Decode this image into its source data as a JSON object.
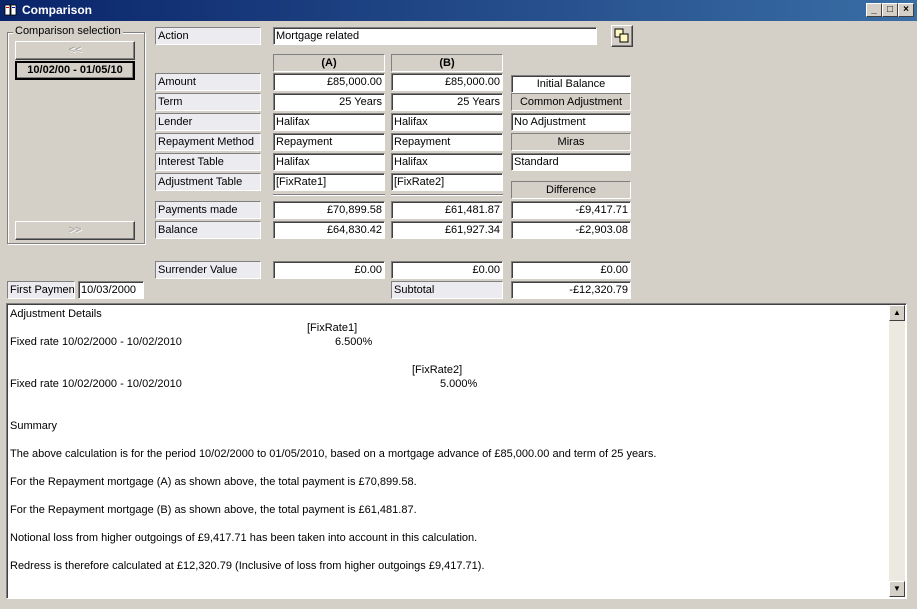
{
  "window": {
    "title": "Comparison"
  },
  "selection": {
    "legend": "Comparison selection",
    "prev_label": "<<",
    "current_label": "10/02/00 - 01/05/10",
    "next_label": ">>"
  },
  "action": {
    "label": "Action",
    "value": "Mortgage related"
  },
  "columns": {
    "a": "(A)",
    "b": "(B)"
  },
  "rows": {
    "amount": {
      "label": "Amount",
      "a": "£85,000.00",
      "b": "£85,000.00"
    },
    "term": {
      "label": "Term",
      "a": "25 Years",
      "b": "25 Years"
    },
    "lender": {
      "label": "Lender",
      "a": "Halifax",
      "b": "Halifax"
    },
    "repayment": {
      "label": "Repayment Method",
      "a": "Repayment",
      "b": "Repayment"
    },
    "interest": {
      "label": "Interest Table",
      "a": "Halifax",
      "b": "Halifax"
    },
    "adjustment": {
      "label": "Adjustment Table",
      "a": "[FixRate1]",
      "b": "[FixRate2]"
    },
    "payments": {
      "label": "Payments made",
      "a": "£70,899.58",
      "b": "£61,481.87",
      "diff": "-£9,417.71"
    },
    "balance": {
      "label": "Balance",
      "a": "£64,830.42",
      "b": "£61,927.34",
      "diff": "-£2,903.08"
    },
    "surrender": {
      "label": "Surrender Value",
      "a": "£0.00",
      "b": "£0.00",
      "diff": "£0.00"
    }
  },
  "right": {
    "initial_balance": "Initial Balance",
    "common_adjustment": "Common Adjustment",
    "no_adjustment": "No Adjustment",
    "miras": "Miras",
    "standard": "Standard",
    "difference": "Difference"
  },
  "subtotal": {
    "label": "Subtotal",
    "value": "-£12,320.79"
  },
  "first_payment": {
    "label": "First Payment",
    "value": "10/03/2000"
  },
  "details": {
    "heading": "Adjustment Details",
    "fix1_name": "[FixRate1]",
    "fix1_desc": "Fixed rate 10/02/2000 - 10/02/2010",
    "fix1_rate": "6.500%",
    "fix2_name": "[FixRate2]",
    "fix2_desc": "Fixed rate 10/02/2000 - 10/02/2010",
    "fix2_rate": "5.000%",
    "summary_heading": "Summary",
    "summary_1": "The above calculation is for the period 10/02/2000 to 01/05/2010, based on a mortgage advance of £85,000.00 and term of 25 years.",
    "summary_2": "For the Repayment mortgage (A) as shown above, the total payment is £70,899.58.",
    "summary_3": "For the Repayment mortgage (B) as shown above, the total payment is £61,481.87.",
    "summary_4": "Notional loss from higher outgoings of £9,417.71 has been taken into account in this calculation.",
    "summary_5": "Redress is therefore calculated at £12,320.79 (Inclusive of loss from higher outgoings £9,417.71)."
  },
  "icons": [
    "window-app-icon",
    "minimize-icon",
    "maximize-icon",
    "close-icon",
    "compare-icon",
    "scroll-up-icon",
    "scroll-down-icon"
  ]
}
